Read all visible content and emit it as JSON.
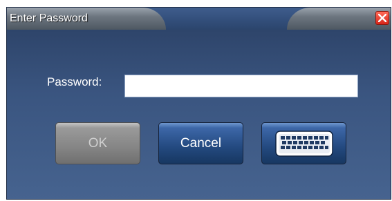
{
  "window": {
    "title": "Enter Password",
    "close_icon": "close-icon"
  },
  "form": {
    "password_label": "Password:",
    "password_value": ""
  },
  "buttons": {
    "ok_label": "OK",
    "cancel_label": "Cancel",
    "keyboard_icon": "keyboard-icon"
  },
  "colors": {
    "dialog_background": "#3a5580",
    "button_blue": "#23497f",
    "button_disabled": "#858585",
    "close_red": "#d7261a"
  }
}
